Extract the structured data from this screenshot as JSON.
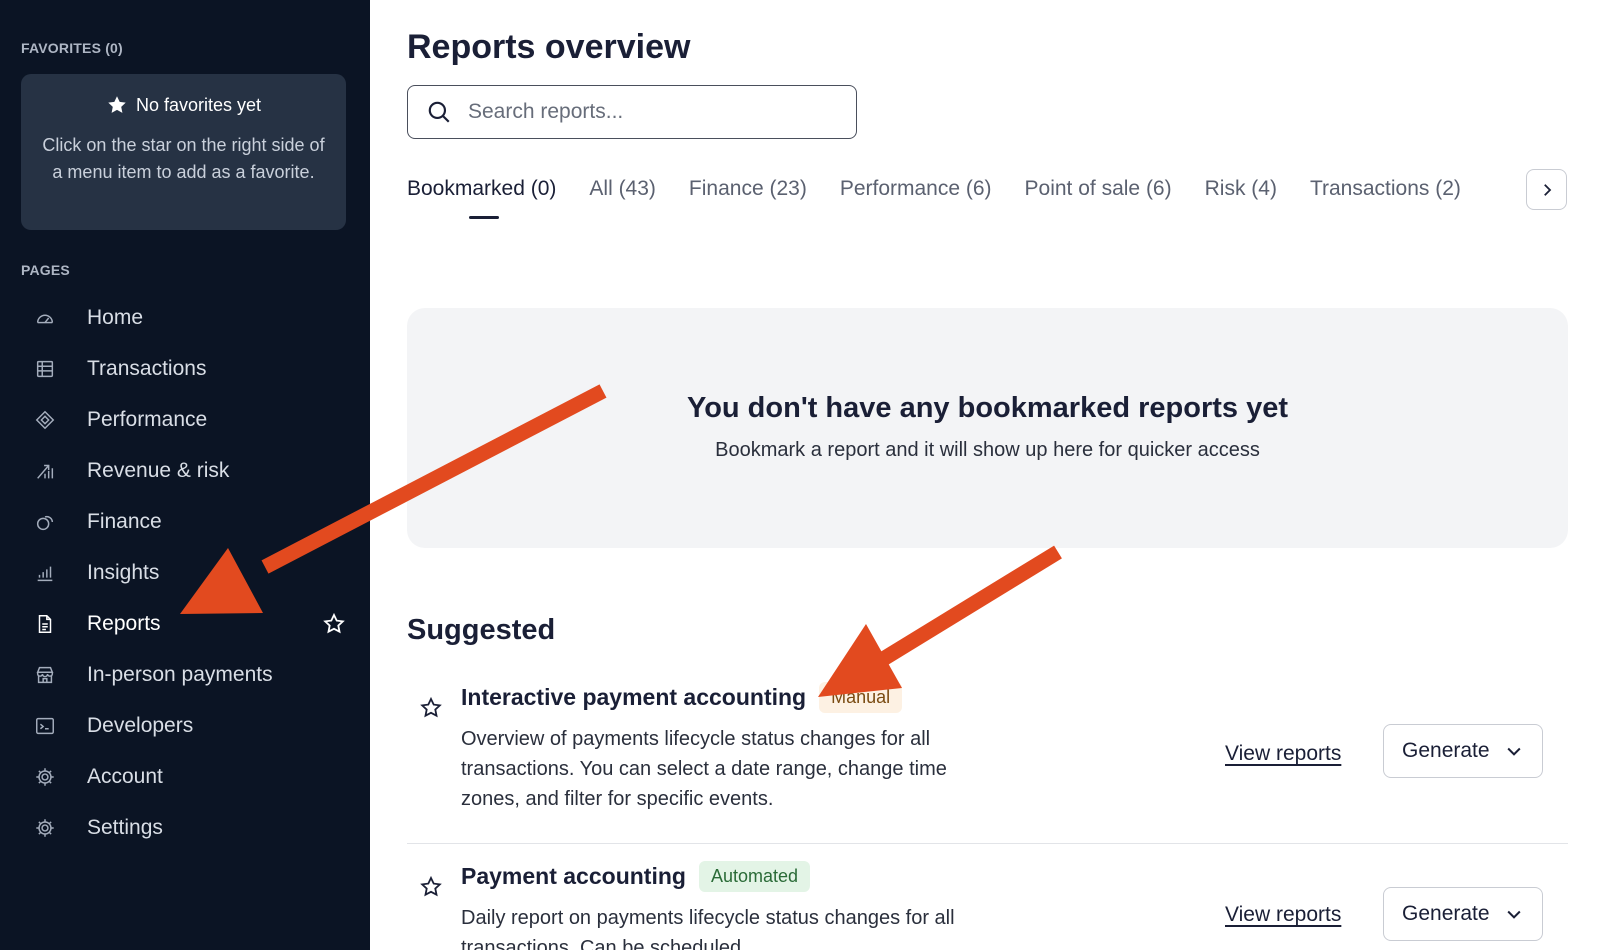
{
  "sidebar": {
    "favorites_label": "FAVORITES (0)",
    "favorites_empty_title": "No favorites yet",
    "favorites_empty_desc": "Click on the star on the right side of a menu item to add as a favorite.",
    "pages_label": "PAGES",
    "items": [
      {
        "label": "Home",
        "icon": "home-gauge-icon"
      },
      {
        "label": "Transactions",
        "icon": "table-icon"
      },
      {
        "label": "Performance",
        "icon": "performance-icon"
      },
      {
        "label": "Revenue & risk",
        "icon": "chart-trend-icon"
      },
      {
        "label": "Finance",
        "icon": "coins-icon"
      },
      {
        "label": "Insights",
        "icon": "bar-chart-icon"
      },
      {
        "label": "Reports",
        "icon": "document-icon",
        "active": true
      },
      {
        "label": "In-person payments",
        "icon": "store-icon"
      },
      {
        "label": "Developers",
        "icon": "terminal-icon"
      },
      {
        "label": "Account",
        "icon": "gear-icon"
      },
      {
        "label": "Settings",
        "icon": "gear-icon"
      }
    ]
  },
  "main": {
    "title": "Reports overview",
    "search": {
      "placeholder": "Search reports..."
    },
    "tabs": [
      {
        "label": "Bookmarked (0)",
        "active": true
      },
      {
        "label": "All (43)"
      },
      {
        "label": "Finance (23)"
      },
      {
        "label": "Performance (6)"
      },
      {
        "label": "Point of sale (6)"
      },
      {
        "label": "Risk (4)"
      },
      {
        "label": "Transactions (2)"
      }
    ],
    "empty": {
      "title": "You don't have any bookmarked reports yet",
      "desc": "Bookmark a report and it will show up here for quicker access"
    },
    "suggested_title": "Suggested",
    "reports": [
      {
        "name": "Interactive payment accounting",
        "badge": "Manual",
        "desc": "Overview of payments lifecycle status changes for all transactions. You can select a date range, change time zones, and filter for specific events.",
        "view_label": "View reports",
        "generate_label": "Generate"
      },
      {
        "name": "Payment accounting",
        "badge": "Automated",
        "desc": "Daily report on payments lifecycle status changes for all transactions. Can be scheduled.",
        "view_label": "View reports",
        "generate_label": "Generate"
      }
    ]
  },
  "colors": {
    "sidebar_bg": "#0b1424",
    "annotation_arrow": "#e24a1f",
    "badge_manual_bg": "#fdf1e3",
    "badge_automated_bg": "#e3f4e6"
  }
}
